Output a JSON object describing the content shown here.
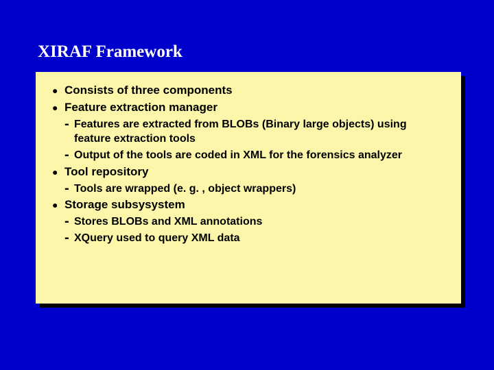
{
  "title": "XIRAF Framework",
  "bullets": {
    "b0": "Consists of three components",
    "b1": "Feature extraction manager",
    "b1_s0": "Features are extracted from BLOBs (Binary large objects) using feature extraction tools",
    "b1_s1": "Output of the tools are coded in XML for the forensics analyzer",
    "b2": "Tool repository",
    "b2_s0": "Tools are wrapped (e. g. , object wrappers)",
    "b3": "Storage subsysystem",
    "b3_s0": "Stores BLOBs and XML annotations",
    "b3_s1": "XQuery used to query XML data"
  }
}
